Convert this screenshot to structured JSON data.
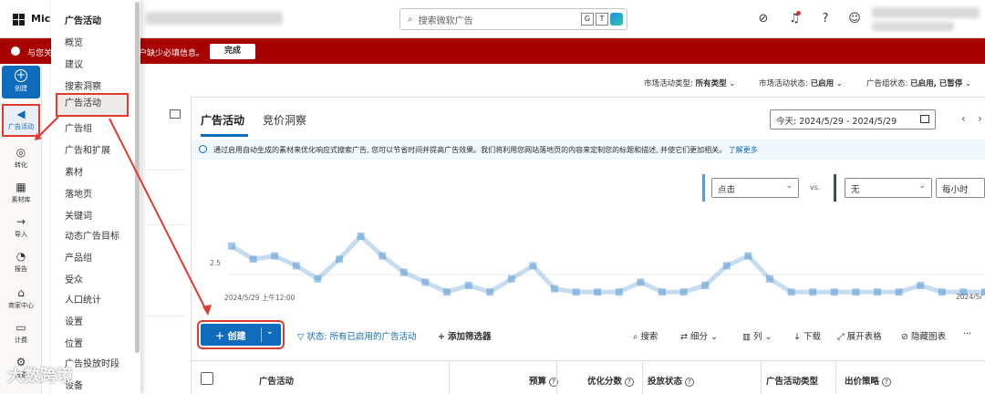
{
  "topbar": {
    "brand": "Micr",
    "search_placeholder": "搜索微软广告",
    "search_ext_g": "G",
    "search_ext_t": "T"
  },
  "banner": {
    "text_a": "与您关",
    "text_b": "户缺少必填信息。",
    "done_label": "完成"
  },
  "rail": {
    "items": [
      {
        "label": "创建",
        "icon": "plus-circle-icon"
      },
      {
        "label": "广告活动",
        "icon": "megaphone-icon"
      },
      {
        "label": "转化",
        "icon": "target-icon"
      },
      {
        "label": "素材库",
        "icon": "library-icon"
      },
      {
        "label": "导入",
        "icon": "import-icon"
      },
      {
        "label": "报告",
        "icon": "report-icon"
      },
      {
        "label": "商家中心",
        "icon": "store-icon"
      },
      {
        "label": "计费",
        "icon": "billing-icon"
      },
      {
        "label": "设置",
        "icon": "gear-icon"
      }
    ]
  },
  "flyout": {
    "header": "广告活动",
    "items": [
      "概览",
      "建议",
      "搜索洞察",
      "广告活动",
      "广告组",
      "广告和扩展",
      "素材",
      "落地页",
      "关键词",
      "动态广告目标",
      "产品组",
      "受众",
      "人口统计",
      "设置",
      "位置",
      "广告投放时段",
      "设备"
    ],
    "active_index": 3
  },
  "filters": {
    "type_label": "市场活动类型:",
    "type_value": "所有类型",
    "status_label": "市场活动状态:",
    "status_value": "已启用",
    "group_label": "广告组状态:",
    "group_value": "已启用, 已暂停"
  },
  "main": {
    "tabs": [
      "广告活动",
      "竞价洞察"
    ],
    "date_range": "今天: 2024/5/29 - 2024/5/29",
    "info_text": "通过启用自动生成的素材来优化响应式搜索广告, 您可以节省时间并提高广告效果。我们将利用您网站落地页的内容来定制您的标题和描述, 并使它们更加相关。",
    "info_link": "了解更多",
    "metric_1": "点击",
    "vs": "vs.",
    "metric_2": "无",
    "granularity": "每小时",
    "chart_start": "2024/5/29 上午12:00",
    "chart_end": "2024/5/"
  },
  "chart_data": {
    "type": "line",
    "ytick": "2.5",
    "ylabel_partial": "",
    "note": "",
    "series": [
      {
        "values": [
          3.2,
          2.8,
          2.9,
          2.6,
          2.2,
          2.8,
          3.5,
          2.9,
          2.4,
          2.1,
          1.8,
          2.0,
          1.8,
          2.2,
          2.6,
          1.9,
          1.8,
          1.8,
          1.8,
          2.1,
          1.8,
          1.8,
          2.0,
          2.6,
          2.9,
          2.2,
          1.8,
          1.8,
          1.8,
          1.8,
          1.8,
          1.8,
          2.0,
          1.8,
          1.8,
          1.8
        ]
      }
    ],
    "color": "#5b9bd5"
  },
  "toolbar": {
    "create": "创建",
    "status_filter": "状态: 所有已启用的广告活动",
    "add_filter": "添加筛选器",
    "search": "搜索",
    "segment": "细分",
    "columns": "列",
    "download": "下载",
    "expand": "展开表格",
    "hide_chart": "隐藏图表",
    "more": "···"
  },
  "table": {
    "columns": [
      "广告活动",
      "预算",
      "优化分数",
      "投放状态",
      "广告活动类型",
      "出价策略"
    ]
  },
  "watermark": "大数跨境"
}
